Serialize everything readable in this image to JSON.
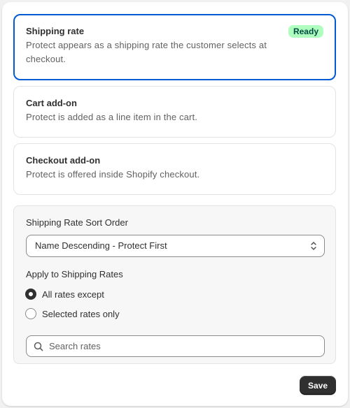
{
  "options": [
    {
      "title": "Shipping rate",
      "description": "Protect appears as a shipping rate the customer selects at checkout.",
      "badge": "Ready",
      "selected": true
    },
    {
      "title": "Cart add-on",
      "description": "Protect is added as a line item in the cart.",
      "selected": false
    },
    {
      "title": "Checkout add-on",
      "description": "Protect is offered inside Shopify checkout.",
      "selected": false
    }
  ],
  "settings": {
    "sort_order_label": "Shipping Rate Sort Order",
    "sort_order_value": "Name Descending - Protect First",
    "apply_label": "Apply to Shipping Rates",
    "radios": [
      {
        "label": "All rates except",
        "checked": true
      },
      {
        "label": "Selected rates only",
        "checked": false
      }
    ],
    "search_placeholder": "Search rates"
  },
  "footer": {
    "save_label": "Save"
  },
  "colors": {
    "accent": "#005bd3",
    "badge_bg": "#affebf",
    "badge_text": "#014b40",
    "primary_button": "#303030"
  },
  "icons": {
    "select": "chevron-up-down-icon",
    "search": "search-icon"
  }
}
